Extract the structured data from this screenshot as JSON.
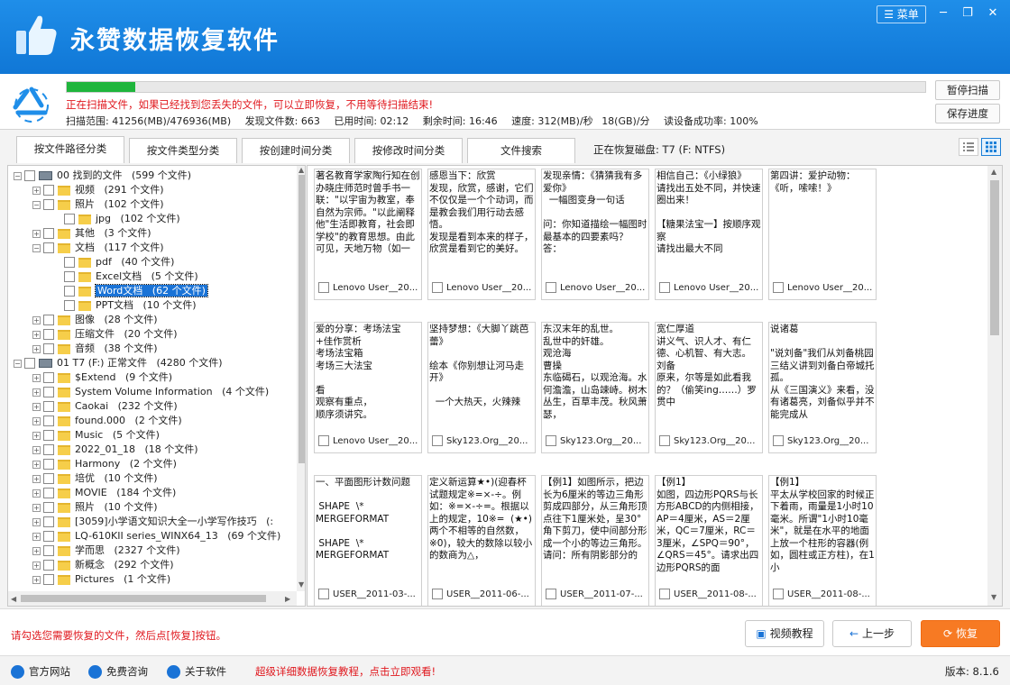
{
  "app": {
    "title": "永赞数据恢复软件",
    "menu_label": "菜单"
  },
  "scan": {
    "progress": 0.08,
    "message": "正在扫描文件，如果已经找到您丢失的文件，可以立即恢复，不用等待扫描结束!",
    "range": "扫描范围: 41256(MB)/476936(MB)",
    "found": "发现文件数: 663",
    "elapsed": "已用时间: 02:12",
    "remaining": "剩余时间: 16:46",
    "speed": "速度: 312(MB)/秒",
    "gb_speed": "18(GB)/分",
    "read_rate": "读设备成功率: 100%",
    "pause_label": "暂停扫描",
    "save_label": "保存进度"
  },
  "tabs": [
    "按文件路径分类",
    "按文件类型分类",
    "按创建时间分类",
    "按修改时间分类",
    "文件搜索"
  ],
  "recovering_disk": "正在恢复磁盘: T7 (F: NTFS)",
  "tree": [
    {
      "label": "00 找到的文件",
      "count": "(599 个文件)"
    },
    {
      "label": "视频",
      "count": "(291 个文件)"
    },
    {
      "label": "照片",
      "count": "(102 个文件)"
    },
    {
      "label": "jpg",
      "count": "(102 个文件)"
    },
    {
      "label": "其他",
      "count": "(3 个文件)"
    },
    {
      "label": "文档",
      "count": "(117 个文件)"
    },
    {
      "label": "pdf",
      "count": "(40 个文件)"
    },
    {
      "label": "Excel文档",
      "count": "(5 个文件)"
    },
    {
      "label": "Word文档",
      "count": "(62 个文件)"
    },
    {
      "label": "PPT文档",
      "count": "(10 个文件)"
    },
    {
      "label": "图像",
      "count": "(28 个文件)"
    },
    {
      "label": "压缩文件",
      "count": "(20 个文件)"
    },
    {
      "label": "音频",
      "count": "(38 个文件)"
    },
    {
      "label": "01 T7 (F:) 正常文件",
      "count": "(4280 个文件)"
    },
    {
      "label": "$Extend",
      "count": "(9 个文件)"
    },
    {
      "label": "System Volume Information",
      "count": "(4 个文件)"
    },
    {
      "label": "Caokai",
      "count": "(232 个文件)"
    },
    {
      "label": "found.000",
      "count": "(2 个文件)"
    },
    {
      "label": "Music",
      "count": "(5 个文件)"
    },
    {
      "label": "2022_01_18",
      "count": "(18 个文件)"
    },
    {
      "label": "Harmony",
      "count": "(2 个文件)"
    },
    {
      "label": "培优",
      "count": "(10 个文件)"
    },
    {
      "label": "MOVIE",
      "count": "(184 个文件)"
    },
    {
      "label": "照片",
      "count": "(10 个文件)"
    },
    {
      "label": "[3059]小学语文知识大全一小学写作技巧",
      "count": "(:"
    },
    {
      "label": "LQ-610KII series_WINX64_13",
      "count": "(69 个文件)"
    },
    {
      "label": "学而思",
      "count": "(2327 个文件)"
    },
    {
      "label": "新概念",
      "count": "(292 个文件)"
    },
    {
      "label": "Pictures",
      "count": "(1 个文件)"
    }
  ],
  "cards": [
    {
      "text": "著名教育学家陶行知在创办晓庄师范时曾手书一联：\"以宇宙为教室，奉自然为宗师。\"以此阐释他\"生活即教育，社会即学校\"的教育思想。由此可见，天地万物（如一",
      "foot": "Lenovo User__20..."
    },
    {
      "text": "感恩当下：欣赏\n发现，欣赏，感谢，它们不仅仅是一个个动词，而是教会我们用行动去感悟。\n发现是看到本来的样子，欣赏是看到它的美好。",
      "foot": "Lenovo User__20..."
    },
    {
      "text": "发现亲情：《猜猜我有多爱你》\n  一幅图变身一句话\n\n问：你知道描绘一幅图时最基本的四要素吗？\n答：",
      "foot": "Lenovo User__20..."
    },
    {
      "text": "相信自己：《小绿狼》\n请找出五处不同，并快速圈出来！\n\n【糖果法宝一】按顺序观察\n请找出最大不同",
      "foot": "Lenovo User__20..."
    },
    {
      "text": "第四讲：爱护动物：《听，嗦嗦！》",
      "foot": "Lenovo User__20..."
    },
    {
      "text": "爱的分享：考场法宝\n+佳作赏析\n考场法宝箱\n考场三大法宝\n\n看\n观察有重点，\n顺序须讲究。",
      "foot": "Lenovo User__20..."
    },
    {
      "text": "坚持梦想：《大脚丫跳芭蕾》\n\n绘本《你别想让河马走开》\n\n  一个大热天，火辣辣",
      "foot": "Sky123.Org__20..."
    },
    {
      "text": "东汉末年的乱世。\n乱世中的奸雄。\n观沧海\n曹操\n东临碣石，以观沧海。水何澹澹，山岛竦峙。树木丛生，百草丰茂。秋风萧瑟，",
      "foot": "Sky123.Org__20..."
    },
    {
      "text": "宽仁厚道\n讲义气、识人才、有仁德、心机智、有大志。\n刘备\n原来，尔等是如此看我的？（偷笑ing……）罗贯中",
      "foot": "Sky123.Org__20..."
    },
    {
      "text": "说诸葛\n\n\"说刘备\"我们从刘备桃园三结义讲到刘备白帝城托孤。\n从《三国演义》来看，没有诸葛亮，刘备似乎并不能完成从",
      "foot": "Sky123.Org__20..."
    },
    {
      "text": "一、平面图形计数问题\n\n SHAPE  \\*\nMERGEFORMAT\n\n SHAPE  \\*\nMERGEFORMAT",
      "foot": "USER__2011-03-..."
    },
    {
      "text": "定义新运算★•)(迎春杯试题规定※=×-÷。例如：※=×-÷=。根据以上的规定，10※=  (★•)两个不相等的自然数，※0)，较大的数除以较小的数商为△，",
      "foot": "USER__2011-06-..."
    },
    {
      "text": "【例1】如图所示，把边长为6厘米的等边三角形剪成四部分，从三角形顶点往下1厘米处，呈30°角下剪刀，使中间部分形成一个小的等边三角形。请问：所有阴影部分的",
      "foot": "USER__2011-07-..."
    },
    {
      "text": "【例1】\n如图，四边形PQRS与长方形ABCD的内侧相接，AP＝4厘米，AS＝2厘米，QC＝7厘米，RC＝3厘米，∠SPQ＝90°，∠QRS＝45°。请求出四边形PQRS的面",
      "foot": "USER__2011-08-..."
    },
    {
      "text": "【例1】\n平太从学校回家的时候正下着雨，雨量是1小时10毫米。所谓\"1小时10毫米\"，就是在水平的地面上放一个柱形的容器(例如，圆柱或正方柱)，在1小",
      "foot": "USER__2011-08-..."
    }
  ],
  "bottom": {
    "hint": "请勾选您需要恢复的文件，然后点[恢复]按钮。",
    "video_label": "视频教程",
    "prev_label": "上一步",
    "recover_label": "恢复"
  },
  "status": {
    "website": "官方网站",
    "consult": "免费咨询",
    "about": "关于软件",
    "tutorial": "超级详细数据恢复教程，点击立即观看!",
    "version": "版本: 8.1.6"
  },
  "colors": {
    "brand_blue": "#1a82e2",
    "progress_green": "#1fb53c",
    "warning_red": "#e0191f",
    "recover_orange": "#f77a23"
  }
}
